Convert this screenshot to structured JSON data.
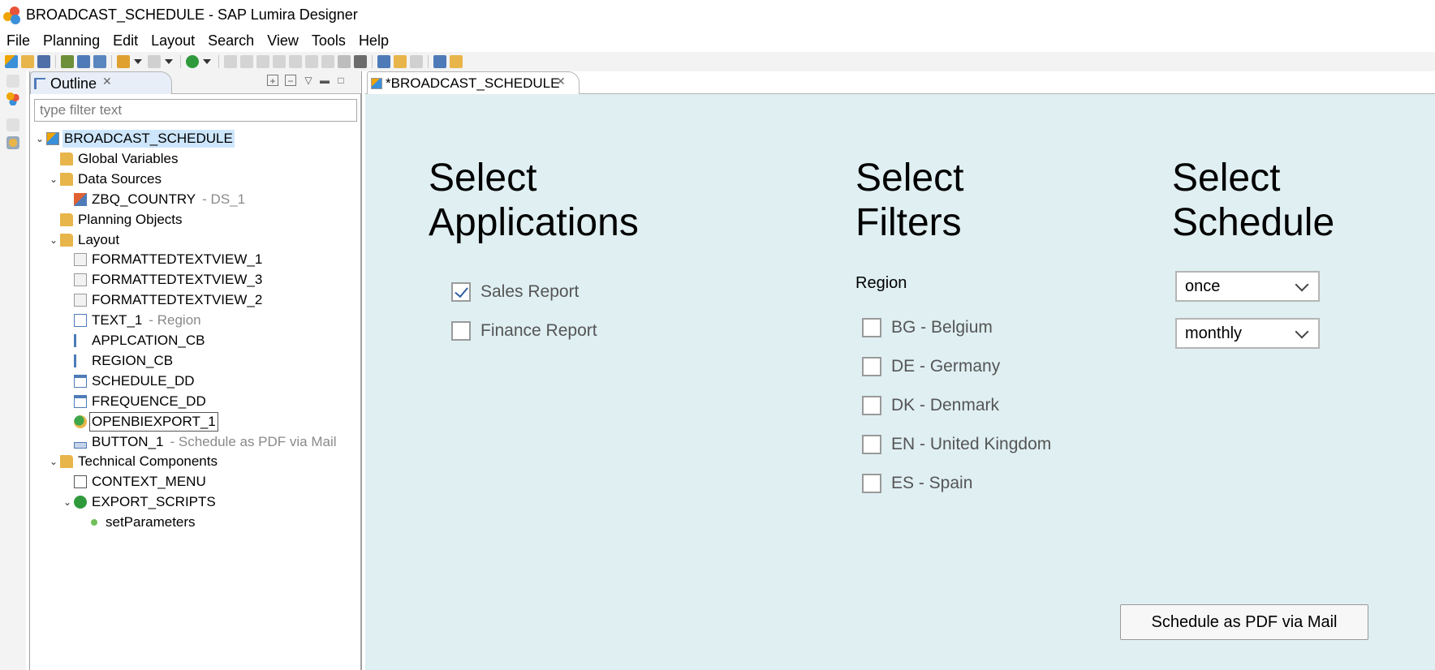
{
  "window": {
    "title": "BROADCAST_SCHEDULE - SAP Lumira Designer"
  },
  "menu": [
    "File",
    "Planning",
    "Edit",
    "Layout",
    "Search",
    "View",
    "Tools",
    "Help"
  ],
  "outline": {
    "tab_label": "Outline",
    "filter_placeholder": "type filter text",
    "tree": [
      {
        "label": "BROADCAST_SCHEDULE",
        "suffix": "",
        "icon": "app-icon",
        "level": 0,
        "twisty": "expanded",
        "selected": true
      },
      {
        "label": "Global Variables",
        "suffix": "",
        "icon": "folder-icon",
        "level": 1,
        "twisty": "none"
      },
      {
        "label": "Data Sources",
        "suffix": "",
        "icon": "folder-icon",
        "level": 1,
        "twisty": "expanded"
      },
      {
        "label": "ZBQ_COUNTRY",
        "suffix": "- DS_1",
        "icon": "datasource-icon",
        "level": 2,
        "twisty": "none"
      },
      {
        "label": "Planning Objects",
        "suffix": "",
        "icon": "folder-icon",
        "level": 1,
        "twisty": "none"
      },
      {
        "label": "Layout",
        "suffix": "",
        "icon": "folder-icon",
        "level": 1,
        "twisty": "expanded"
      },
      {
        "label": "FORMATTEDTEXTVIEW_1",
        "suffix": "",
        "icon": "formatted-text-icon",
        "level": 2,
        "twisty": "none"
      },
      {
        "label": "FORMATTEDTEXTVIEW_3",
        "suffix": "",
        "icon": "formatted-text-icon",
        "level": 2,
        "twisty": "none"
      },
      {
        "label": "FORMATTEDTEXTVIEW_2",
        "suffix": "",
        "icon": "formatted-text-icon",
        "level": 2,
        "twisty": "none"
      },
      {
        "label": "TEXT_1",
        "suffix": "- Region",
        "icon": "text-icon",
        "level": 2,
        "twisty": "none"
      },
      {
        "label": "APPLCATION_CB",
        "suffix": "",
        "icon": "checkbox-group-icon",
        "level": 2,
        "twisty": "none"
      },
      {
        "label": "REGION_CB",
        "suffix": "",
        "icon": "checkbox-group-icon",
        "level": 2,
        "twisty": "none"
      },
      {
        "label": "SCHEDULE_DD",
        "suffix": "",
        "icon": "dropdown-icon",
        "level": 2,
        "twisty": "none"
      },
      {
        "label": "FREQUENCE_DD",
        "suffix": "",
        "icon": "dropdown-icon",
        "level": 2,
        "twisty": "none"
      },
      {
        "label": "OPENBIEXPORT_1",
        "suffix": "",
        "icon": "export-icon",
        "level": 2,
        "twisty": "none",
        "focused": true
      },
      {
        "label": "BUTTON_1",
        "suffix": "- Schedule as PDF via Mail",
        "icon": "button-icon",
        "level": 2,
        "twisty": "none"
      },
      {
        "label": "Technical Components",
        "suffix": "",
        "icon": "folder-icon",
        "level": 1,
        "twisty": "expanded"
      },
      {
        "label": "CONTEXT_MENU",
        "suffix": "",
        "icon": "context-menu-icon",
        "level": 2,
        "twisty": "none"
      },
      {
        "label": "EXPORT_SCRIPTS",
        "suffix": "",
        "icon": "script-icon",
        "level": 2,
        "twisty": "expanded"
      },
      {
        "label": "setParameters",
        "suffix": "",
        "icon": "function-icon",
        "level": 3,
        "twisty": "none"
      }
    ]
  },
  "editor": {
    "tab_label": "*BROADCAST_SCHEDULE",
    "headings": {
      "applications": [
        "Select",
        "Applications"
      ],
      "filters": [
        "Select",
        "Filters"
      ],
      "schedule": [
        "Select",
        "Schedule"
      ]
    },
    "applications": [
      {
        "label": "Sales Report",
        "checked": true
      },
      {
        "label": "Finance Report",
        "checked": false
      }
    ],
    "region_label": "Region",
    "regions": [
      {
        "label": "BG - Belgium",
        "checked": false
      },
      {
        "label": "DE - Germany",
        "checked": false
      },
      {
        "label": "DK - Denmark",
        "checked": false
      },
      {
        "label": "EN - United Kingdom",
        "checked": false
      },
      {
        "label": "ES - Spain",
        "checked": false
      }
    ],
    "schedule_dd": "once",
    "frequency_dd": "monthly",
    "action_button": "Schedule as PDF via Mail"
  },
  "colors": {
    "canvas_bg": "#dfeff2",
    "selection": "#cde6fb",
    "checkmark": "#2e5da0",
    "folder": "#e8b54a"
  }
}
